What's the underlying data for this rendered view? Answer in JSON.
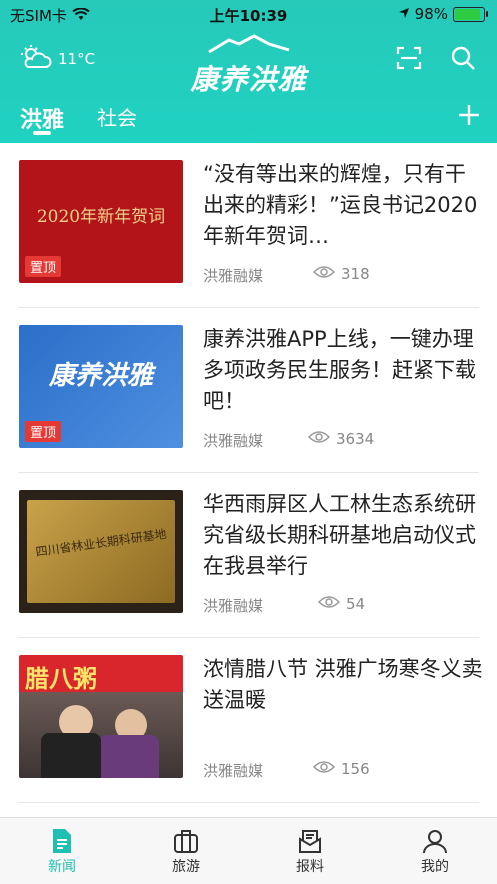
{
  "status": {
    "carrier": "无SIM卡",
    "time": "上午10:39",
    "battery": "98%",
    "battery_level": 0.98
  },
  "header": {
    "temperature": "11°C",
    "logo_text": "康养洪雅"
  },
  "tabs": [
    {
      "label": "洪雅"
    },
    {
      "label": "社会"
    }
  ],
  "articles": [
    {
      "title": "“没有等出来的辉煌，只有干出来的精彩！”运良书记2020年新年贺词…",
      "source": "洪雅融媒",
      "views": "318",
      "pinned": true,
      "thumb_text": "2020年新年贺词"
    },
    {
      "title": "康养洪雅APP上线，一键办理多项政务民生服务！赶紧下载吧！",
      "source": "洪雅融媒",
      "views": "3634",
      "pinned": true,
      "thumb_text": "康养洪雅"
    },
    {
      "title": "华西雨屏区人工林生态系统研究省级长期科研基地启动仪式在我县举行",
      "source": "洪雅融媒",
      "views": "54",
      "pinned": false,
      "thumb_text": "四川省林业长期科研基地"
    },
    {
      "title": "浓情腊八节 洪雅广场寒冬义卖送温暖",
      "source": "洪雅融媒",
      "views": "156",
      "pinned": false,
      "thumb_text": "腊八粥"
    }
  ],
  "pin_label": "置顶",
  "tabbar": [
    {
      "label": "新闻"
    },
    {
      "label": "旅游"
    },
    {
      "label": "报料"
    },
    {
      "label": "我的"
    }
  ],
  "colors": {
    "accent": "#1fc0b1",
    "pin": "#e53935"
  }
}
